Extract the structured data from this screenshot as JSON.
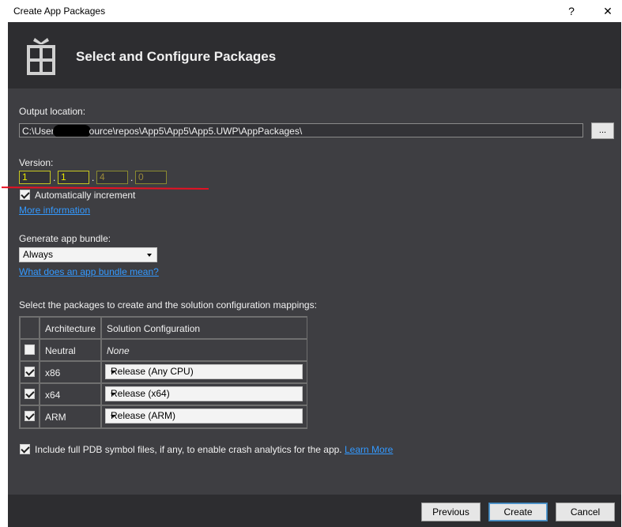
{
  "window": {
    "title": "Create App Packages",
    "help_label": "?",
    "close_label": "✕"
  },
  "header": {
    "icon": "package-icon",
    "title": "Select and Configure Packages"
  },
  "output": {
    "label": "Output location:",
    "path_prefix": "C:\\User",
    "path_suffix": "ource\\repos\\App5\\App5\\App5.UWP\\AppPackages\\",
    "browse_label": "..."
  },
  "version": {
    "label": "Version:",
    "parts": [
      "1",
      "1",
      "4",
      "0"
    ],
    "separator": ".",
    "auto_increment_label": "Automatically increment",
    "auto_increment_checked": true,
    "more_info_link": "More information"
  },
  "bundle": {
    "label": "Generate app bundle:",
    "selected": "Always",
    "help_link": "What does an app bundle mean?"
  },
  "packages": {
    "label": "Select the packages to create and the solution configuration mappings:",
    "headers": {
      "architecture": "Architecture",
      "configuration": "Solution Configuration"
    },
    "rows": [
      {
        "arch": "Neutral",
        "config": "None",
        "checked": false
      },
      {
        "arch": "x86",
        "config": "Release (Any CPU)",
        "checked": true
      },
      {
        "arch": "x64",
        "config": "Release (x64)",
        "checked": true
      },
      {
        "arch": "ARM",
        "config": "Release (ARM)",
        "checked": true
      }
    ]
  },
  "pdb": {
    "label": "Include full PDB symbol files, if any, to enable crash analytics for the app.",
    "checked": true,
    "learn_more_link": "Learn More"
  },
  "footer": {
    "previous_label": "Previous",
    "create_label": "Create",
    "cancel_label": "Cancel"
  },
  "colors": {
    "background": "#3e3e42",
    "header": "#2d2d30",
    "link": "#3399ff",
    "version_highlight": "#e8e800",
    "annotation_line": "#e81123"
  }
}
